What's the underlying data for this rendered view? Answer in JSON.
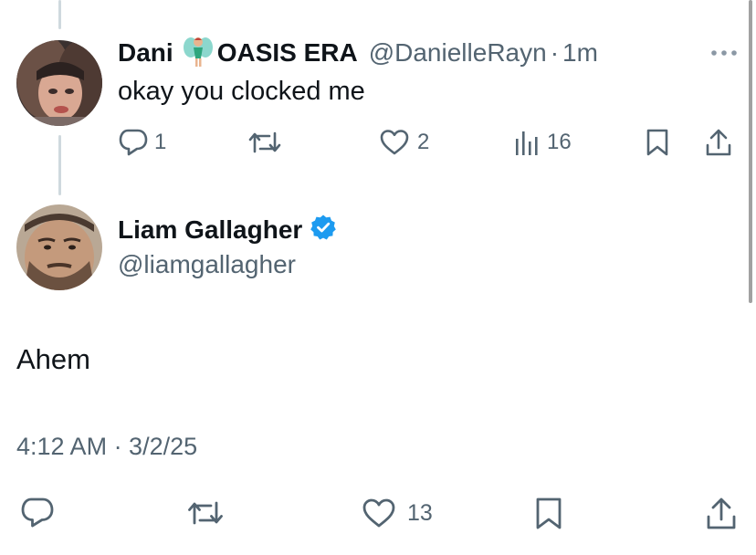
{
  "reply_tweet": {
    "display_name_part1": "Dani",
    "display_name_emoji": "fairy-emoji",
    "display_name_part2": "OASIS ERA",
    "handle": "@DanielleRayn",
    "separator": "·",
    "time_ago": "1m",
    "text": "okay you clocked me",
    "replies": "1",
    "retweets": "",
    "likes": "2",
    "views": "16"
  },
  "main_tweet": {
    "display_name": "Liam Gallagher",
    "verified": true,
    "handle": "@liamgallagher",
    "text": "Ahem",
    "timestamp": "4:12 AM · 3/2/25",
    "likes": "13"
  },
  "colors": {
    "text": "#0f1419",
    "muted": "#536471",
    "verified": "#1d9bf0",
    "thread_line": "#cfd9de"
  }
}
